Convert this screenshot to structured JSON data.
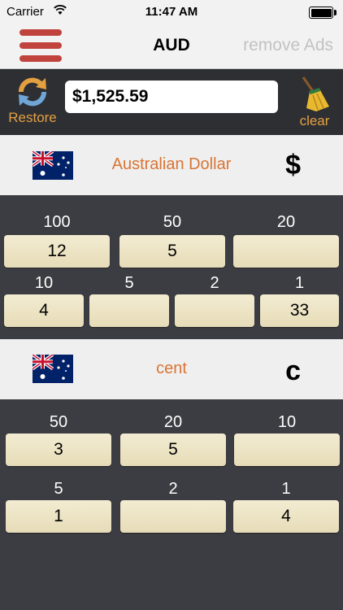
{
  "status_bar": {
    "carrier": "Carrier",
    "time": "11:47 AM"
  },
  "nav": {
    "title": "AUD",
    "remove_ads": "remove Ads"
  },
  "toolbar": {
    "restore_label": "Restore",
    "amount": "$1,525.59",
    "clear_label": "clear"
  },
  "dollar_section": {
    "name": "Australian Dollar",
    "symbol": "$",
    "row1": [
      {
        "denom": "100",
        "count": "12"
      },
      {
        "denom": "50",
        "count": "5"
      },
      {
        "denom": "20",
        "count": ""
      }
    ],
    "row2": [
      {
        "denom": "10",
        "count": "4"
      },
      {
        "denom": "5",
        "count": ""
      },
      {
        "denom": "2",
        "count": ""
      },
      {
        "denom": "1",
        "count": "33"
      }
    ]
  },
  "cent_section": {
    "name": "cent",
    "symbol": "c",
    "row1": [
      {
        "denom": "50",
        "count": "3"
      },
      {
        "denom": "20",
        "count": "5"
      },
      {
        "denom": "10",
        "count": ""
      }
    ],
    "row2": [
      {
        "denom": "5",
        "count": "1"
      },
      {
        "denom": "2",
        "count": ""
      },
      {
        "denom": "1",
        "count": "4"
      }
    ]
  },
  "colors": {
    "menu": "#c0443d",
    "accent": "#e3a041",
    "currency_name": "#d97433",
    "background": "#3c3d42"
  },
  "icons": {
    "menu": "hamburger-icon",
    "restore": "refresh-icon",
    "clear": "broom-icon",
    "flag": "australia-flag-icon"
  }
}
